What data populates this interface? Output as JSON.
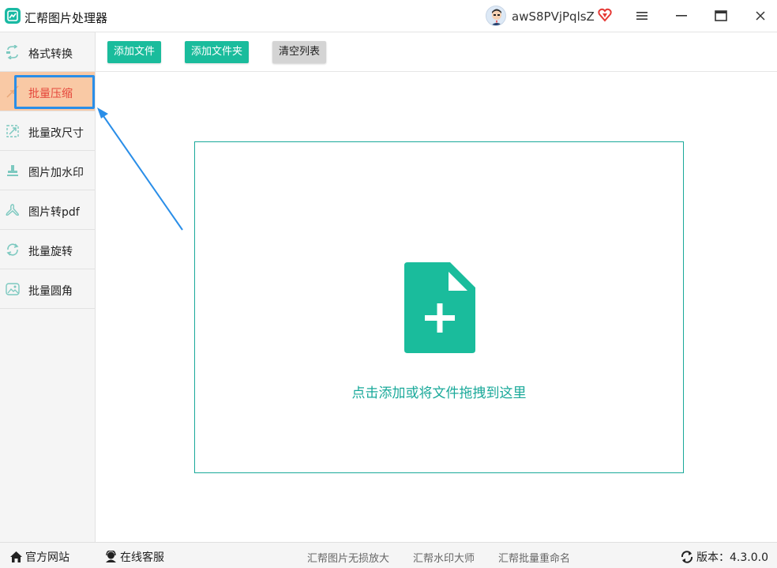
{
  "app": {
    "title": "汇帮图片处理器",
    "accent_color": "#1abc9c",
    "active_color": "#f9c9a5",
    "active_text_color": "#e5463a"
  },
  "titlebar": {
    "username": "awS8PVjPqlsZ",
    "icons": [
      "avatar",
      "vip-heart-icon",
      "menu-icon",
      "minimize-icon",
      "maximize-icon",
      "close-icon"
    ]
  },
  "sidebar": {
    "items": [
      {
        "label": "格式转换",
        "icon": "format-convert-icon",
        "active": false
      },
      {
        "label": "批量压缩",
        "icon": "compress-icon",
        "active": true
      },
      {
        "label": "批量改尺寸",
        "icon": "resize-icon",
        "active": false
      },
      {
        "label": "图片加水印",
        "icon": "watermark-icon",
        "active": false
      },
      {
        "label": "图片转pdf",
        "icon": "pdf-icon",
        "active": false
      },
      {
        "label": "批量旋转",
        "icon": "rotate-icon",
        "active": false
      },
      {
        "label": "批量圆角",
        "icon": "rounded-corner-icon",
        "active": false
      }
    ]
  },
  "toolbar": {
    "add_file": "添加文件",
    "add_folder": "添加文件夹",
    "clear_list": "清空列表"
  },
  "dropzone": {
    "text": "点击添加或将文件拖拽到这里",
    "icon": "add-file-icon"
  },
  "footer": {
    "website": "官方网站",
    "support": "在线客服",
    "promos": [
      "汇帮图片无损放大",
      "汇帮水印大师",
      "汇帮批量重命名"
    ],
    "version_label": "版本：4.3.0.0"
  }
}
